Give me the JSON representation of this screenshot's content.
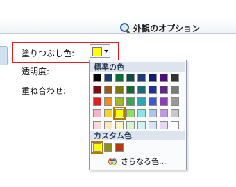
{
  "header": {
    "title": "外観のオプション",
    "icon": "search-icon"
  },
  "fields": [
    {
      "label": "塗りつぶし色:"
    },
    {
      "label": "透明度:"
    },
    {
      "label": "重ね合わせ:"
    }
  ],
  "fill_color": {
    "value": "#ffff00"
  },
  "palette": {
    "standard_title": "標準の色",
    "standard_colors": [
      [
        "#000000",
        "#1a3b6e",
        "#0b6d3a",
        "#0a4f3f",
        "#1f3a7a",
        "#0b1e73",
        "#4b0b78",
        "#333333"
      ],
      [
        "#7a0f0f",
        "#9a5a10",
        "#7a7a0e",
        "#146a2d",
        "#1c6a73",
        "#1f2f9e",
        "#5d2a7f",
        "#7a7a7a"
      ],
      [
        "#e31d1d",
        "#f08c1c",
        "#9fb824",
        "#35a64c",
        "#2aa7b5",
        "#3c5ad4",
        "#8a3db6",
        "#9a9a9a"
      ],
      [
        "#f3b3c8",
        "#f7d51e",
        "#ffff00",
        "#8ae05a",
        "#8fe3e6",
        "#a9c7f2",
        "#c09be3",
        "#c8c8c8"
      ],
      [
        "#f9d8d8",
        "#f9e8b8",
        "#fbf7c8",
        "#d9f5cf",
        "#d1f3f2",
        "#d9e4f9",
        "#e5d7f5",
        "#ffffff"
      ]
    ],
    "selected_color": "#ffff00",
    "custom_title": "カスタム色",
    "custom_colors": [
      "#ffff00",
      "#8f8f0e",
      "#b23a0b"
    ],
    "more_label": "さらなる色...",
    "more_icon": "palette-icon"
  }
}
